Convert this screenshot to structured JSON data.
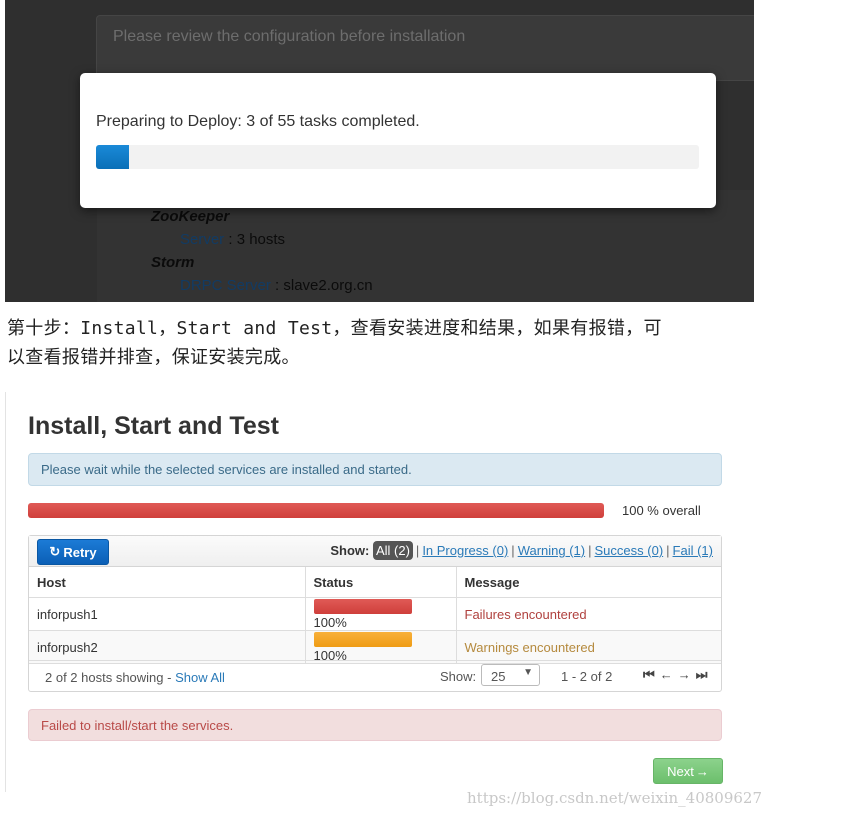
{
  "top_screenshot": {
    "background_banner": "Please review the configuration before installation",
    "modal_message": "Preparing to Deploy: 3 of 55 tasks completed.",
    "modal_progress": 0.055,
    "summary": {
      "zookeeper_name": "ZooKeeper",
      "zookeeper_key": "Server",
      "zookeeper_value": " : 3 hosts",
      "storm_name": "Storm",
      "storm_key": "DRPC Server",
      "storm_value": " : slave2.org.cn"
    }
  },
  "caption": {
    "line1": "第十步：Install，Start and Test，查看安装进度和结果，如果有报错，可",
    "line2": "以查看报错并排查，保证安装完成。"
  },
  "install": {
    "title": "Install, Start and Test",
    "info": "Please wait while the selected services are installed and started.",
    "overall_progress": 1.0,
    "overall_label": "100 % overall",
    "retry_label": "Retry",
    "filters": {
      "show_label": "Show:",
      "all": "All (2)",
      "in_progress": "In Progress (0)",
      "warning": "Warning (1)",
      "success": "Success (0)",
      "fail": "Fail (1)"
    },
    "columns": [
      "Host",
      "Status",
      "Message"
    ],
    "rows": [
      {
        "host": "inforpush1",
        "percent": "100%",
        "progress": 1.0,
        "status_color": "#d9534f",
        "message": "Failures encountered"
      },
      {
        "host": "inforpush2",
        "percent": "100%",
        "progress": 1.0,
        "status_color": "#f0a020",
        "message": "Warnings encountered"
      }
    ],
    "footer": {
      "count_text": "2 of 2 hosts showing - ",
      "show_all": "Show All",
      "show_label": "Show:",
      "page_size": "25",
      "range": "1 - 2 of 2"
    },
    "error": "Failed to install/start the services.",
    "next_label": "Next"
  },
  "watermark": "https://blog.csdn.net/weixin_40809627"
}
